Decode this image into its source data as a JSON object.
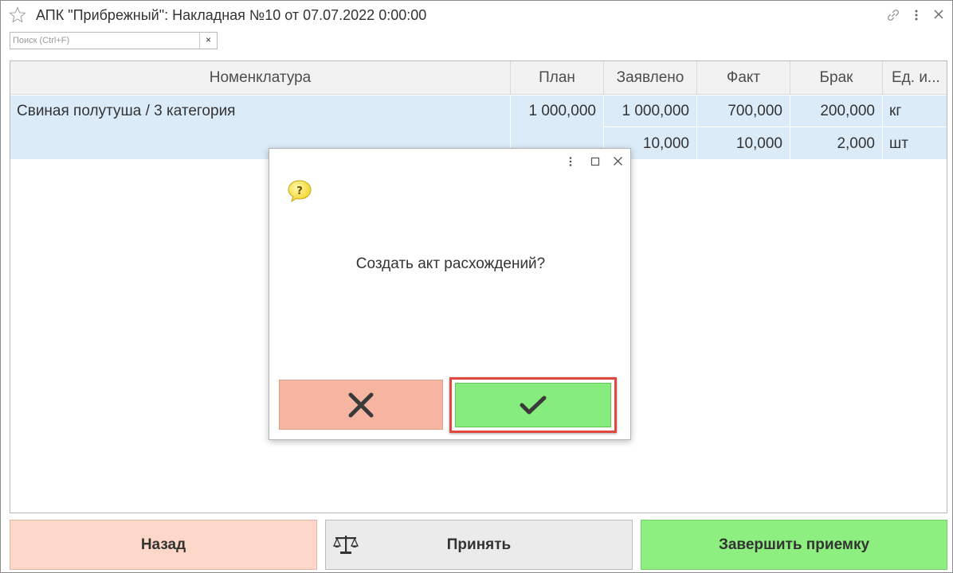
{
  "title": "АПК \"Прибрежный\": Накладная №10 от 07.07.2022 0:00:00",
  "search": {
    "placeholder": "Поиск (Ctrl+F)",
    "clear_label": "×"
  },
  "table": {
    "columns": [
      "Номенклатура",
      "План",
      "Заявлено",
      "Факт",
      "Брак",
      "Ед. и..."
    ],
    "rows": [
      {
        "name": "Свиная полутуша / 3 категория",
        "plan": "1 000,000",
        "declared": "1 000,000",
        "fact": "700,000",
        "defect": "200,000",
        "unit": "кг"
      },
      {
        "name": "",
        "plan": "",
        "declared": "10,000",
        "fact": "10,000",
        "defect": "2,000",
        "unit": "шт"
      }
    ]
  },
  "dialog": {
    "message": "Создать акт расхождений?",
    "cancel_icon": "x-icon",
    "ok_icon": "checkmark-icon",
    "cancel_color": "#f5b5a0",
    "ok_color": "#86ec7e",
    "ok_highlight_color": "#e0473f"
  },
  "buttons": {
    "back": "Назад",
    "accept": "Принять",
    "finish": "Завершить приемку"
  },
  "colors": {
    "row_selected": "#dcebf8",
    "back_button": "#fdd7c8",
    "accept_button": "#ebebeb",
    "finish_button": "#8def7f"
  }
}
